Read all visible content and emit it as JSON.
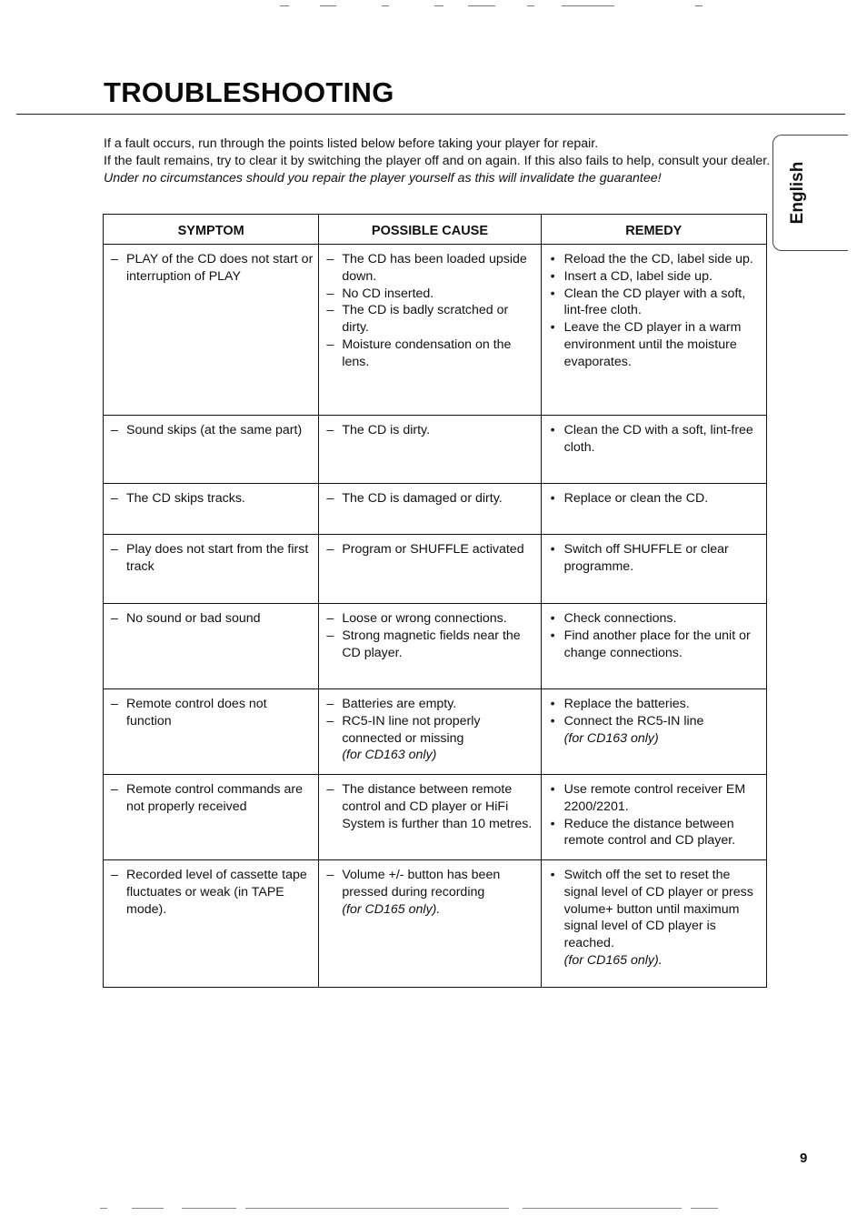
{
  "page": {
    "title": "TROUBLESHOOTING",
    "language_tab": "English",
    "page_number": "9"
  },
  "intro": {
    "line1": "If a fault occurs, run through the points listed below before taking your player for repair.",
    "line2": "If the fault remains, try to clear it by switching the player off and on again. If this also fails to help, consult your dealer.",
    "warning": "Under no circumstances should you repair the player yourself as this will invalidate the guarantee!"
  },
  "table": {
    "headers": [
      "SYMPTOM",
      "POSSIBLE CAUSE",
      "REMEDY"
    ],
    "rows": [
      {
        "symptom": [
          {
            "text": "PLAY of the CD does not start or interruption of PLAY"
          }
        ],
        "causes": [
          {
            "text": "The CD has been loaded upside down."
          },
          {
            "text": "No CD inserted."
          },
          {
            "text": "The CD is badly scratched or dirty."
          },
          {
            "text": "Moisture condensation on the lens."
          }
        ],
        "remedies": [
          {
            "text": "Reload the the CD, label side up."
          },
          {
            "text": "Insert a CD, label side up."
          },
          {
            "text": "Clean the CD player with a soft, lint-free cloth."
          },
          {
            "text": "Leave the CD player in a warm environment until the moisture evaporates."
          }
        ]
      },
      {
        "symptom": [
          {
            "text": "Sound skips (at the same part)"
          }
        ],
        "causes": [
          {
            "text": "The CD is dirty."
          }
        ],
        "remedies": [
          {
            "text": "Clean the CD with a soft, lint-free cloth."
          }
        ]
      },
      {
        "symptom": [
          {
            "text": "The CD skips tracks."
          }
        ],
        "causes": [
          {
            "text": "The CD is damaged or dirty."
          }
        ],
        "remedies": [
          {
            "text": "Replace or clean the CD."
          }
        ]
      },
      {
        "symptom": [
          {
            "text": "Play does not start from the first track"
          }
        ],
        "causes": [
          {
            "text": "Program or SHUFFLE activated"
          }
        ],
        "remedies": [
          {
            "text": "Switch off SHUFFLE or clear programme."
          }
        ]
      },
      {
        "symptom": [
          {
            "text": "No sound or bad sound"
          }
        ],
        "causes": [
          {
            "text": "Loose or wrong connections."
          },
          {
            "text": "Strong magnetic fields near the CD player."
          }
        ],
        "remedies": [
          {
            "text": "Check connections."
          },
          {
            "text": "Find another place for the unit or change connections."
          }
        ]
      },
      {
        "symptom": [
          {
            "text": "Remote control does not function"
          }
        ],
        "causes": [
          {
            "text": "Batteries are empty."
          },
          {
            "text": "RC5-IN line not  properly connected or missing",
            "note": "(for CD163 only)"
          }
        ],
        "remedies": [
          {
            "text": "Replace the batteries."
          },
          {
            "text": "Connect the RC5-IN line",
            "note": "(for CD163 only)"
          }
        ]
      },
      {
        "symptom": [
          {
            "text": "Remote control commands are not properly received"
          }
        ],
        "causes": [
          {
            "text": "The distance between remote control and CD player or HiFi System is further than 10 metres."
          }
        ],
        "remedies": [
          {
            "text": "Use remote control receiver EM 2200/2201."
          },
          {
            "text": "Reduce the distance between remote control and CD player."
          }
        ]
      },
      {
        "symptom": [
          {
            "text": "Recorded level of cassette tape fluctuates or weak (in TAPE mode)."
          }
        ],
        "causes": [
          {
            "text": "Volume +/- button has been pressed during recording",
            "note": "(for CD165 only)."
          }
        ],
        "remedies": [
          {
            "text": "Switch off the set to reset the signal level of CD player or press volume+ button until maximum signal level of CD player is reached.",
            "note": "(for CD165 only)."
          }
        ]
      }
    ],
    "markers": {
      "dash": "–",
      "bullet": "•"
    }
  }
}
